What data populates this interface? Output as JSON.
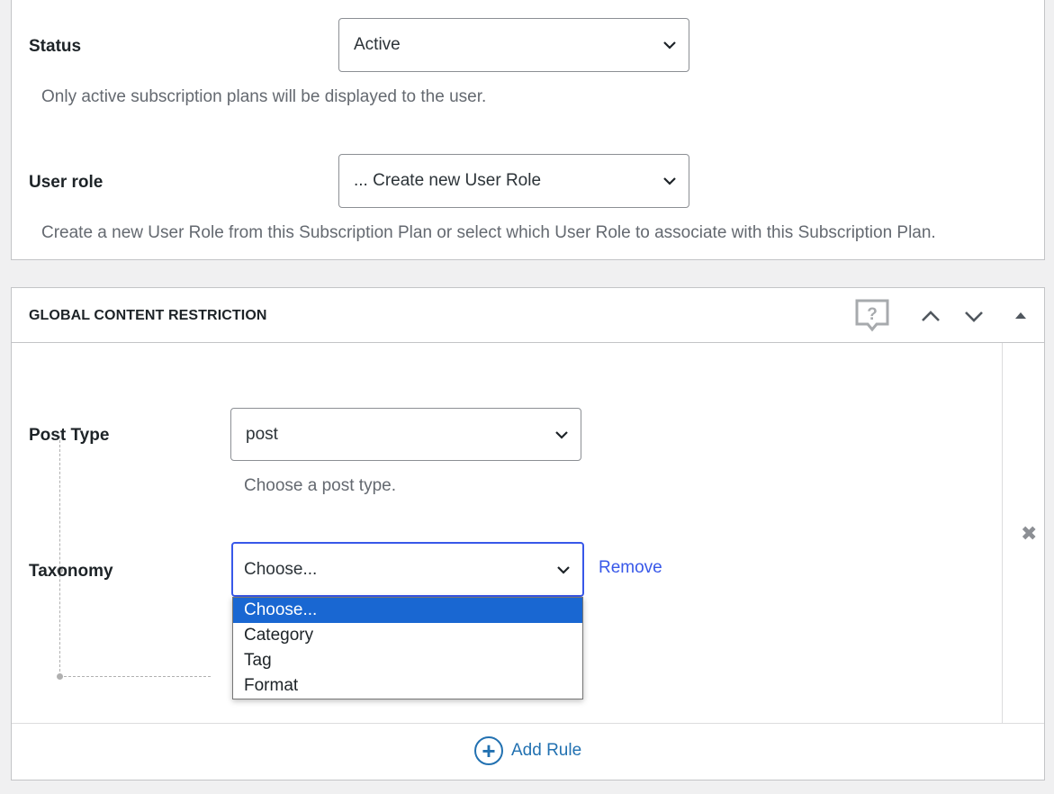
{
  "status": {
    "label": "Status",
    "value": "Active",
    "description": "Only active subscription plans will be displayed to the user."
  },
  "user_role": {
    "label": "User role",
    "value": "... Create new User Role",
    "description": "Create a new User Role from this Subscription Plan or select which User Role to associate with this Subscription Plan."
  },
  "gcr": {
    "title": "GLOBAL CONTENT RESTRICTION",
    "help_icon": "help-bubble-icon",
    "post_type": {
      "label": "Post Type",
      "value": "post",
      "description": "Choose a post type."
    },
    "taxonomy": {
      "label": "Taxonomy",
      "value": "Choose...",
      "remove_label": "Remove",
      "options": [
        "Choose...",
        "Category",
        "Tag",
        "Format"
      ]
    },
    "add_rule_label": "Add Rule",
    "close_icon": "✖"
  },
  "colors": {
    "link": "#3858e9",
    "accent": "#2271b1",
    "selected_option": "#1967d2",
    "focus_border": "#3858e9"
  }
}
